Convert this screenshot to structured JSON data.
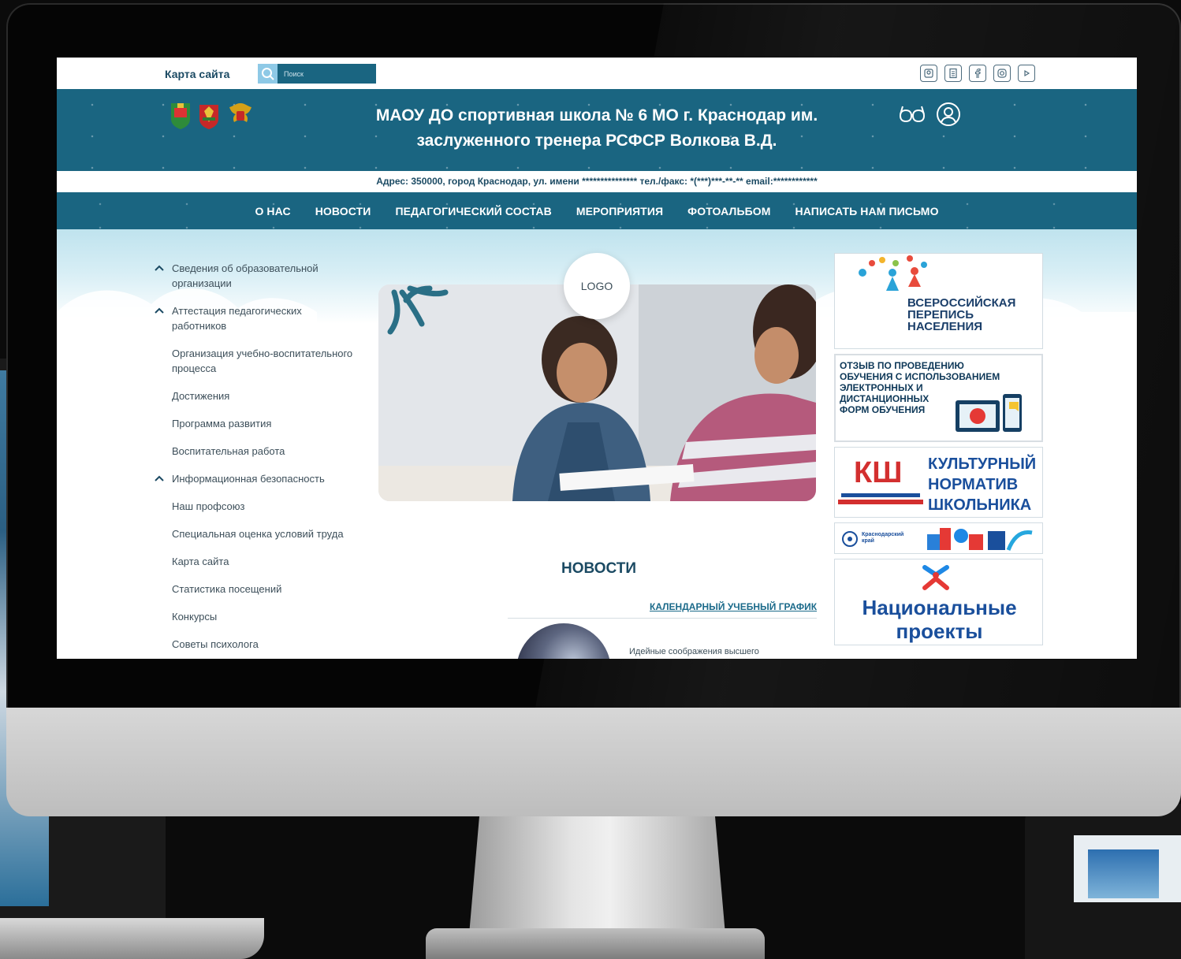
{
  "topbar": {
    "sitemap_label": "Карта сайта",
    "search_placeholder": "Поиск"
  },
  "header": {
    "title": "МАОУ ДО спортивная школа № 6 МО г. Краснодар им. заслуженного тренера РСФСР Волкова В.Д.",
    "address": "Адрес:  350000, город Краснодар, ул. имени ***************  тел./факс: *(***)***-**-**  email:************"
  },
  "nav": [
    "О НАС",
    "НОВОСТИ",
    "ПЕДАГОГИЧЕСКИЙ СОСТАВ",
    "МЕРОПРИЯТИЯ",
    "ФОТОАЛЬБОМ",
    "НАПИСАТЬ НАМ ПИСЬМО"
  ],
  "sidemenu": [
    {
      "label": "Сведения об образовательной организации",
      "expandable": true
    },
    {
      "label": "Аттестация педагогических работников",
      "expandable": true
    },
    {
      "label": "Организация учебно-воспитательного процесса",
      "expandable": false
    },
    {
      "label": "Достижения",
      "expandable": false
    },
    {
      "label": "Программа развития",
      "expandable": false
    },
    {
      "label": "Воспитательная работа",
      "expandable": false
    },
    {
      "label": "Информационная безопасность",
      "expandable": true
    },
    {
      "label": "Наш профсоюз",
      "expandable": false
    },
    {
      "label": "Специальная оценка условий труда",
      "expandable": false
    },
    {
      "label": "Карта сайта",
      "expandable": false
    },
    {
      "label": "Статистика посещений",
      "expandable": false
    },
    {
      "label": "Конкурсы",
      "expandable": false
    },
    {
      "label": "Советы психолога",
      "expandable": false
    }
  ],
  "slider": {
    "logo_text": "LOGO"
  },
  "news": {
    "heading": "НОВОСТИ",
    "item_title": "КАЛЕНДАРНЫЙ УЧЕБНЫЙ ГРАФИК",
    "item_excerpt": "Идейные соображения высшего"
  },
  "banners": {
    "census": [
      "ВСЕРОССИЙСКАЯ",
      "ПЕРЕПИСЬ",
      "НАСЕЛЕНИЯ"
    ],
    "feedback": [
      "ОТЗЫВ ПО ПРОВЕДЕНИЮ",
      "ОБУЧЕНИЯ С ИСПОЛЬЗОВАНИЕМ",
      "ЭЛЕКТРОННЫХ И",
      "ДИСТАНЦИОННЫХ",
      "ФОРМ ОБУЧЕНИЯ"
    ],
    "culture": [
      "КУЛЬТУРНЫЙ",
      "НОРМАТИВ",
      "ШКОЛЬНИКА"
    ],
    "culture_logo": "КШ",
    "krasnodar": "Краснодарский край",
    "national": [
      "Национальные",
      "проекты"
    ]
  },
  "colors": {
    "primary": "#1a6581",
    "accent": "#8ec9e6",
    "text_dark": "#1b4a63"
  }
}
